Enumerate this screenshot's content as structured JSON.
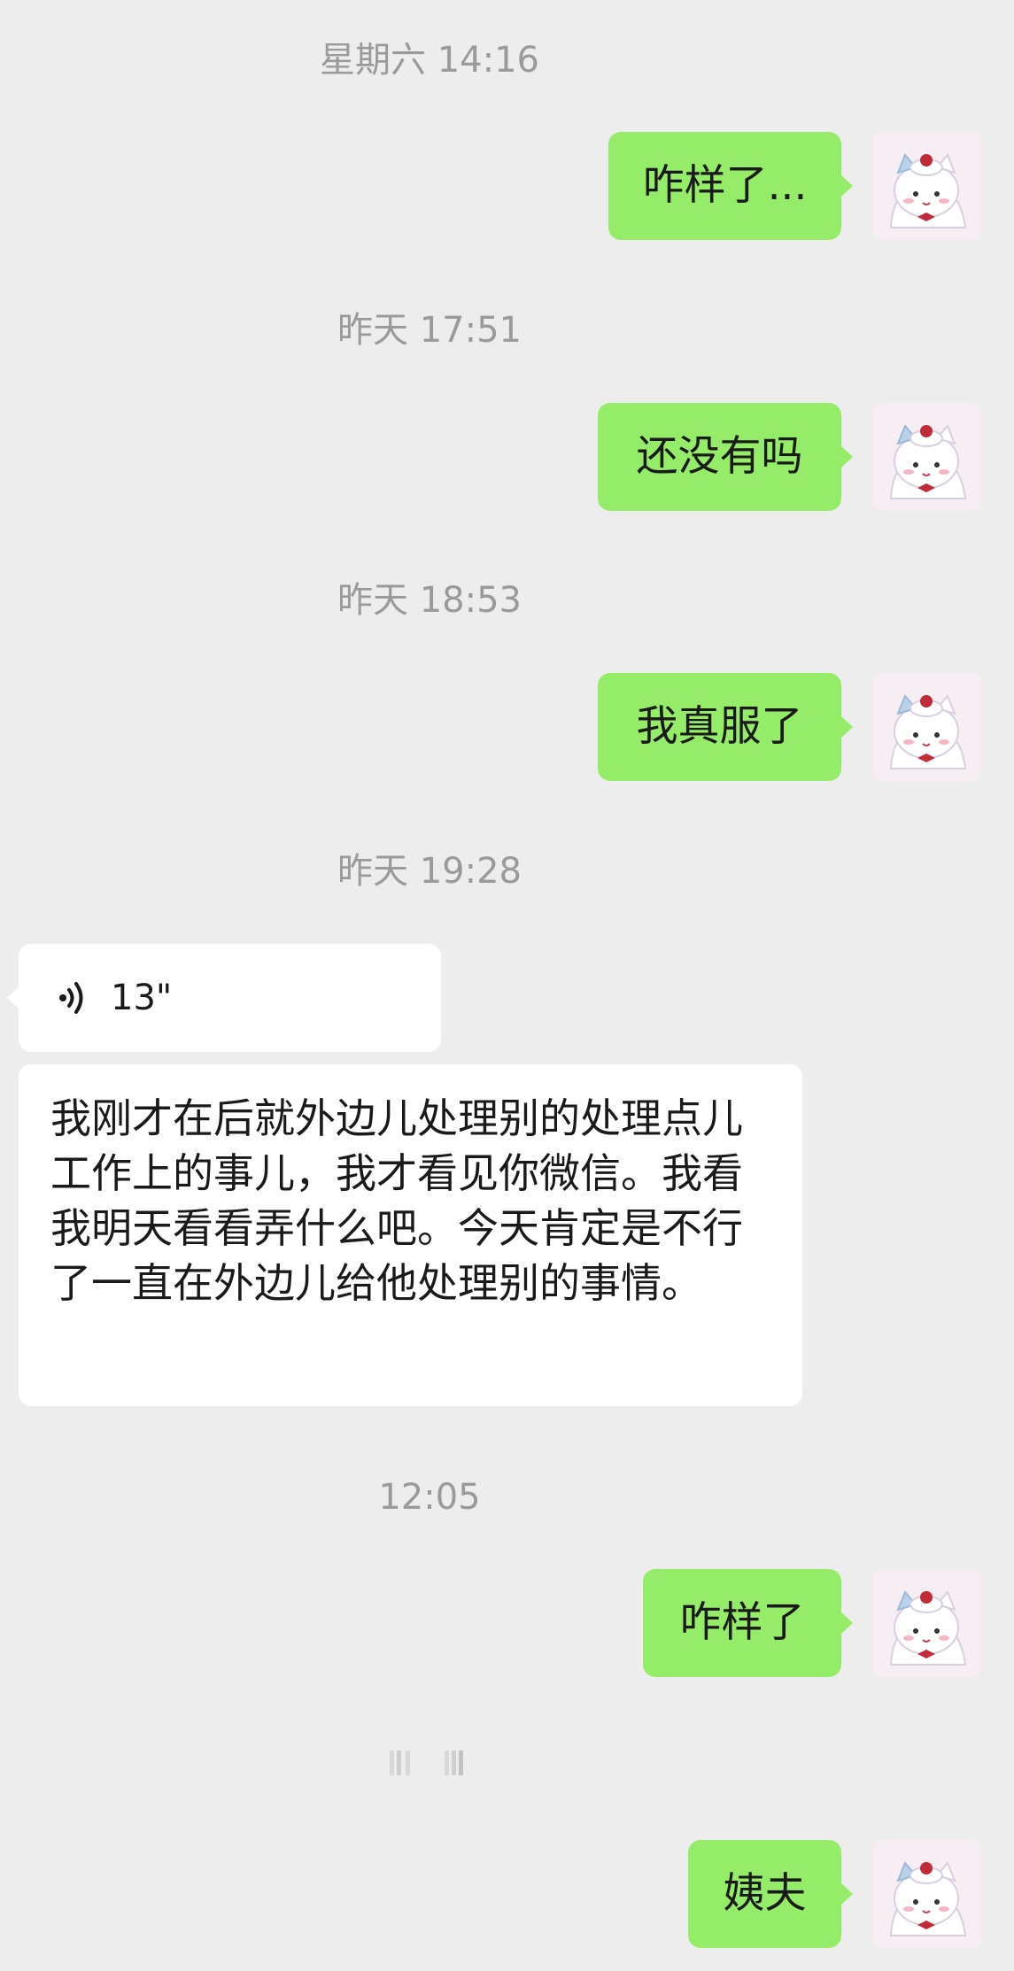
{
  "messages": [
    {
      "type": "timestamp",
      "text": "星期六 14:16"
    },
    {
      "type": "outgoing",
      "text": "咋样了..."
    },
    {
      "type": "timestamp",
      "text": "昨天 17:51"
    },
    {
      "type": "outgoing",
      "text": "还没有吗"
    },
    {
      "type": "timestamp",
      "text": "昨天 18:53"
    },
    {
      "type": "outgoing",
      "text": "我真服了"
    },
    {
      "type": "timestamp",
      "text": "昨天 19:28"
    },
    {
      "type": "voice",
      "duration": "13\"",
      "icon": "voice-wave-icon"
    },
    {
      "type": "incoming",
      "text": "我刚才在后就外边儿处理别的处理点儿工作上的事儿，我才看见你微信。我看我明天看看弄什么吧。今天肯定是不行了一直在外边儿给他处理别的事情。"
    },
    {
      "type": "timestamp",
      "text": "12:05"
    },
    {
      "type": "outgoing",
      "text": "咋样了"
    },
    {
      "type": "outgoing",
      "text": "姨夫"
    }
  ],
  "colors": {
    "background": "#ededed",
    "outgoing_bubble": "#95ec69",
    "incoming_bubble": "#ffffff",
    "timestamp": "#9a9a9a"
  },
  "avatar": {
    "icon": "cat-avatar-icon"
  },
  "loading": {
    "icon": "loading-icon"
  }
}
